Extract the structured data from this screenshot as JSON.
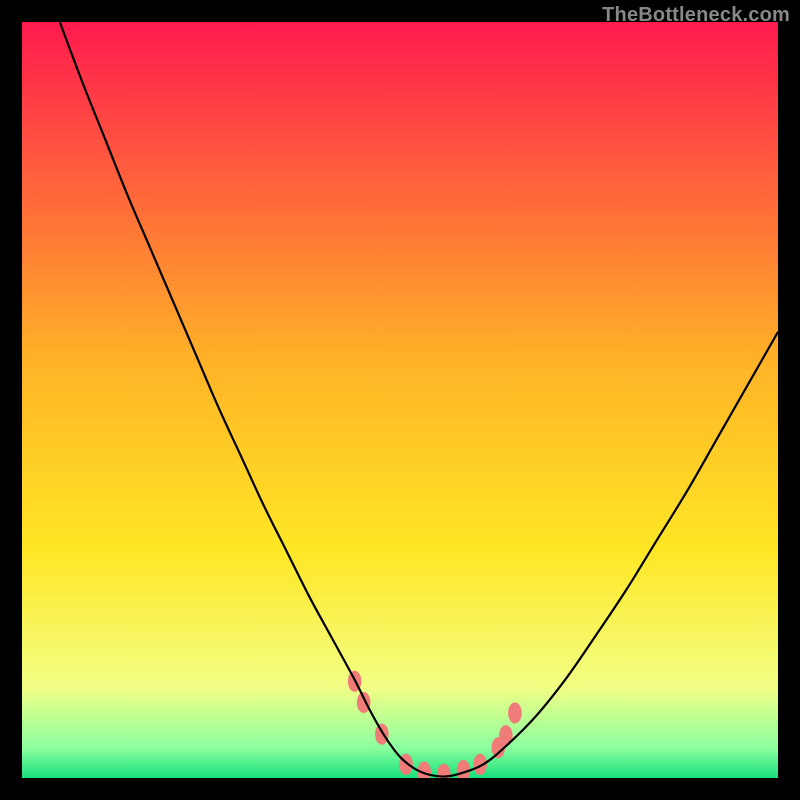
{
  "watermark": "TheBottleneck.com",
  "chart_data": {
    "type": "line",
    "title": "",
    "xlabel": "",
    "ylabel": "",
    "xlim": [
      0,
      100
    ],
    "ylim": [
      0,
      100
    ],
    "grid": false,
    "legend": false,
    "background_gradient": {
      "stops": [
        {
          "pos": 0.0,
          "color": "#ff1a4e"
        },
        {
          "pos": 0.45,
          "color": "#ffb327"
        },
        {
          "pos": 0.7,
          "color": "#ffe725"
        },
        {
          "pos": 0.88,
          "color": "#f2ff85"
        },
        {
          "pos": 0.96,
          "color": "#8cff9f"
        },
        {
          "pos": 1.0,
          "color": "#17e07c"
        }
      ]
    },
    "series": [
      {
        "name": "bottleneck-curve",
        "color": "#000000",
        "x": [
          5,
          8,
          11,
          14,
          17,
          20,
          23,
          26,
          29,
          32,
          35,
          38,
          41,
          44,
          46,
          48,
          50,
          52,
          54,
          56,
          58,
          61,
          64,
          68,
          72,
          76,
          80,
          84,
          88,
          92,
          96,
          100
        ],
        "y": [
          100,
          92,
          84.5,
          77,
          70,
          63,
          56,
          49,
          42.5,
          36,
          30,
          24,
          18.5,
          13,
          9,
          5.5,
          2.8,
          1.2,
          0.4,
          0.2,
          0.6,
          1.8,
          4.2,
          8.2,
          13.2,
          19,
          25,
          31.5,
          38,
          45,
          52,
          59
        ]
      }
    ],
    "markers": {
      "name": "trough-knots",
      "color": "#ef7c78",
      "radius_pct_x": 0.9,
      "radius_pct_y": 1.4,
      "points": [
        {
          "x": 44.0,
          "y": 12.8
        },
        {
          "x": 45.2,
          "y": 10.0
        },
        {
          "x": 47.6,
          "y": 5.8
        },
        {
          "x": 50.8,
          "y": 1.8
        },
        {
          "x": 53.2,
          "y": 0.8
        },
        {
          "x": 55.8,
          "y": 0.5
        },
        {
          "x": 58.4,
          "y": 1.0
        },
        {
          "x": 60.6,
          "y": 1.8
        },
        {
          "x": 63.0,
          "y": 4.0
        },
        {
          "x": 64.0,
          "y": 5.6
        },
        {
          "x": 65.2,
          "y": 8.6
        }
      ]
    }
  }
}
